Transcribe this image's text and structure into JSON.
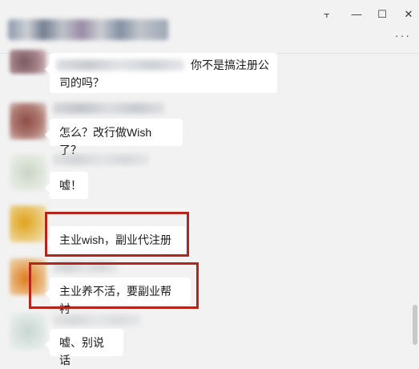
{
  "window": {
    "controls": {
      "pin": "⫟",
      "minimize": "—",
      "maximize": "☐",
      "close": "✕"
    },
    "more": "···"
  },
  "messages": [
    {
      "text_line1": "你不是搞注册公",
      "text_line2": "司的吗？"
    },
    {
      "text": "怎么？改行做Wish了？"
    },
    {
      "text": "嘘！"
    },
    {
      "text": "主业wish，副业代注册",
      "highlighted": true
    },
    {
      "text": "主业养不活，要副业帮衬",
      "highlighted": true
    },
    {
      "text": "嘘、别说话"
    }
  ],
  "colors": {
    "highlight": "#b3261e",
    "bubble": "#ffffff",
    "background": "#f2f2f2"
  }
}
